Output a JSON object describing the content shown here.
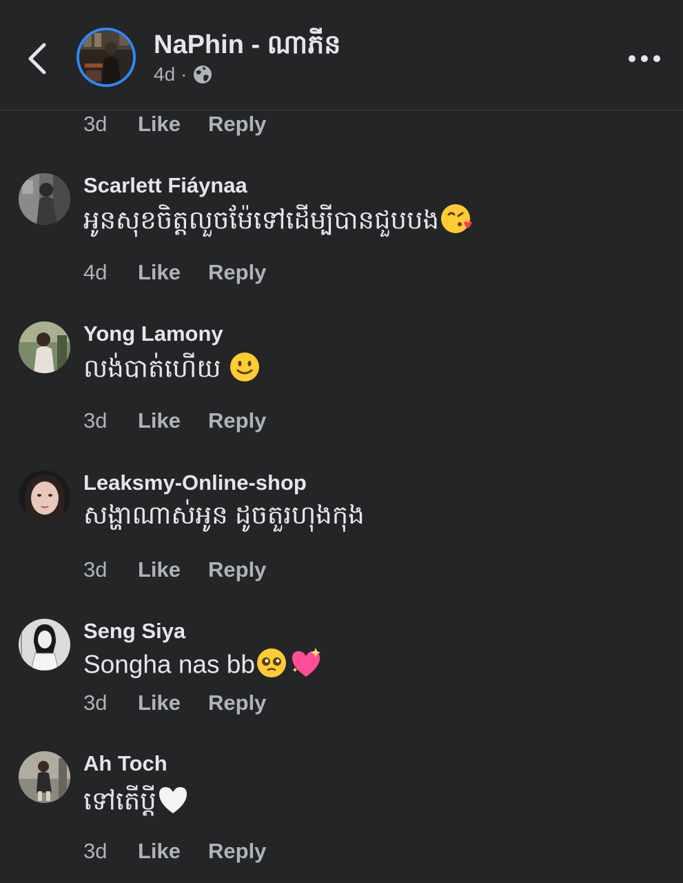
{
  "header": {
    "page_name": "NaPhin - ណាភីន",
    "post_age": "4d",
    "separator": "·",
    "back_icon": "chevron-left-icon",
    "privacy_icon": "globe-icon",
    "more_icon": "more-horizontal-icon"
  },
  "labels": {
    "like": "Like",
    "reply": "Reply"
  },
  "top_partial": {
    "time": "3d"
  },
  "comments": [
    {
      "author": "Scarlett Fiáynaa",
      "text": "អូនសុខចិត្តលួចម៉ែទៅដើម្បីបានជួបបង",
      "emoji": [
        "kissing-heart-emoji"
      ],
      "time": "4d"
    },
    {
      "author": "Yong Lamony",
      "text": "លង់បាត់ហើយ ",
      "emoji": [
        "slight-smile-emoji"
      ],
      "time": "3d"
    },
    {
      "author": "Leaksmy-Online-shop",
      "text": "សង្ហាណាស់អូន ដូចតួរហុងកុង",
      "emoji": [],
      "time": "3d"
    },
    {
      "author": "Seng Siya",
      "text": "Songha nas bb",
      "emoji": [
        "pleading-face-emoji",
        "sparkling-heart-emoji"
      ],
      "time": "3d"
    },
    {
      "author": "Ah Toch",
      "text": "ទៅតើប្ដី",
      "emoji": [
        "white-heart-emoji"
      ],
      "time": "3d"
    }
  ],
  "colors": {
    "background": "#242526",
    "primary_text": "#e4e6eb",
    "secondary_text": "#b0b3b8",
    "story_ring": "#2d88ff",
    "divider": "#3e4042"
  }
}
